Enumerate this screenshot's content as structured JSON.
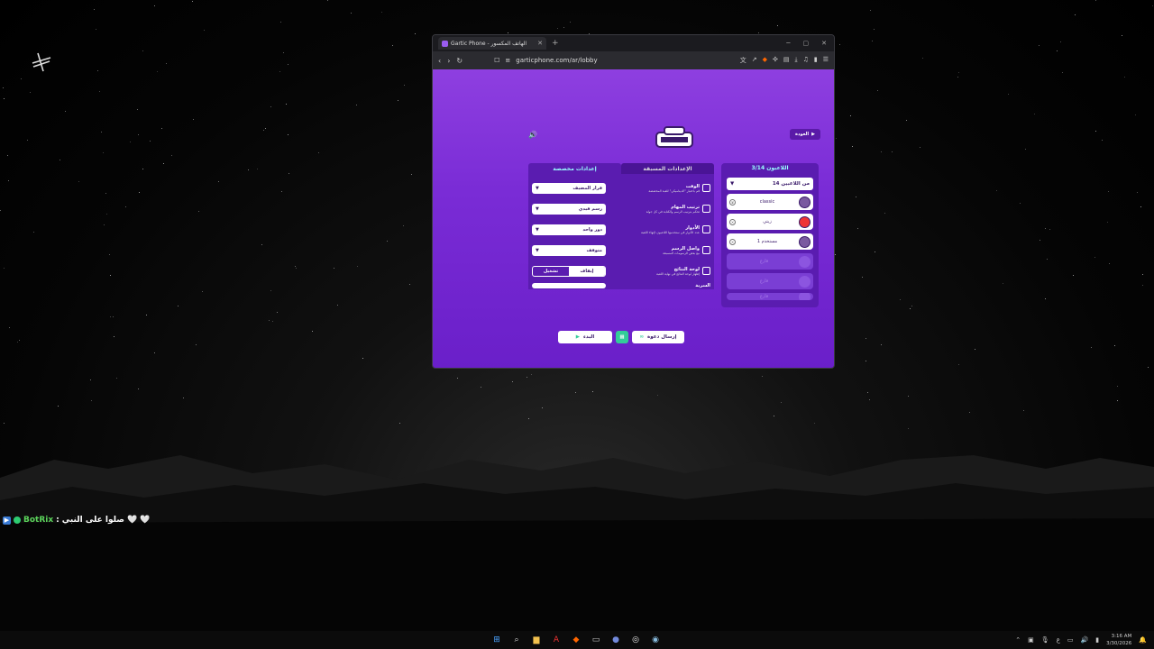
{
  "chat": {
    "bot": "BotRix",
    "separator": ":",
    "message": "صلوا على النبي",
    "hearts": "🤍 🤍"
  },
  "browser": {
    "tab_title": "Gartic Phone - الهاتف المكسور",
    "url": "garticphone.com/ar/lobby"
  },
  "game": {
    "back_label": "العودة",
    "players": {
      "header": "اللاعبون 3/14",
      "select_value": "14 من اللاعبين",
      "list": [
        {
          "name": "classic",
          "empty": false
        },
        {
          "name": "زيتي",
          "empty": false
        },
        {
          "name": "مستخدم 1",
          "empty": false
        },
        {
          "name": "فارغ",
          "empty": true
        },
        {
          "name": "فارغ",
          "empty": true
        },
        {
          "name": "فارغ",
          "empty": true
        }
      ]
    },
    "settings": {
      "tab_presets": "الإعدادات المسبقة",
      "tab_custom": "إعدادات مخصصة",
      "rows": [
        {
          "title": "الوقت",
          "desc": "قم باختيار \"الديناميكي\" للعبة المخصصة",
          "value": "قرار المضيف",
          "type": "select"
        },
        {
          "title": "ترتيب المهام",
          "desc": "تحكم بترتيب الرسم والكتابة في كل جولة",
          "value": "رسم فيدي",
          "type": "select"
        },
        {
          "title": "الأدوار",
          "desc": "عدد الأدوار في ستخدمها اللاعبون لإنهاء اللعبة",
          "value": "دور واحد",
          "type": "select"
        },
        {
          "title": "واصل الرسم",
          "desc": "مع بعض الرسومات المسبقة",
          "value": "متوقف",
          "type": "select"
        },
        {
          "title": "لوحة النتائج",
          "desc": "إظهار لوحة النتائج في نهاية اللعبة",
          "type": "toggle",
          "on_label": "إيقاف",
          "off_label": "تشغيل"
        },
        {
          "title": "السرية",
          "desc": "",
          "type": "cut"
        }
      ]
    },
    "buttons": {
      "invite": "إرسال دعوة",
      "start": "البدء"
    }
  },
  "taskbar": {
    "time": "3:16 AM",
    "date": "3/30/2026"
  },
  "colors": {
    "page_purple": "#7a2cd6",
    "panel": "#5a1cb0",
    "accent_cyan": "#99ffff"
  }
}
